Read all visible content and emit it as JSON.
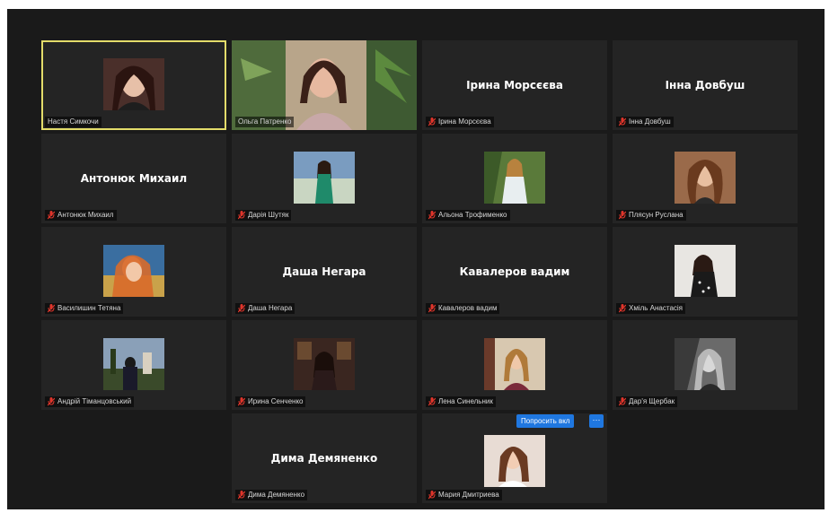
{
  "participants": [
    {
      "name": "Настя Симкочи",
      "mic": "",
      "video": true
    },
    {
      "name": "Ольга Патренко",
      "mic": "",
      "video": true
    },
    {
      "name": "Ірина Морсєєва",
      "display": "Ірина Морсєєва",
      "mic": "muted",
      "video": false
    },
    {
      "name": "Інна Довбуш",
      "display": "Інна Довбуш",
      "mic": "muted",
      "video": false
    },
    {
      "name": "Антонюк Михаил",
      "display": "Антонюк Михаил",
      "mic": "muted",
      "video": false
    },
    {
      "name": "Дарія Шутяк",
      "mic": "muted",
      "video": true
    },
    {
      "name": "Альона Трофименко",
      "mic": "muted",
      "video": true
    },
    {
      "name": "Плясун Руслана",
      "mic": "muted",
      "video": true
    },
    {
      "name": "Василишин Тетяна",
      "mic": "muted",
      "video": true
    },
    {
      "name": "Даша Негара",
      "display": "Даша Негара",
      "mic": "muted",
      "video": false
    },
    {
      "name": "Кавалеров вадим",
      "display": "Кавалеров вадим",
      "mic": "muted",
      "video": false
    },
    {
      "name": "Хміль Анастасія",
      "mic": "muted",
      "video": true
    },
    {
      "name": "Андрій Тіманцовський",
      "mic": "muted",
      "video": true
    },
    {
      "name": "Ирина Сенченко",
      "mic": "muted",
      "video": true
    },
    {
      "name": "Лена Синельник",
      "mic": "muted",
      "video": true
    },
    {
      "name": "Дар'я Щербак",
      "mic": "muted",
      "video": true
    },
    {
      "name": "Дима Демяненко",
      "display": "Дима Демяненко",
      "mic": "muted",
      "video": false
    },
    {
      "name": "Мария Дмитриева",
      "mic": "muted",
      "video": true
    }
  ],
  "hover_actions": {
    "ask_label": "Попросить вкл",
    "more_label": "···"
  },
  "colors": {
    "window_bg": "#1a1a1a",
    "tile_bg": "#242424",
    "active_speaker_border": "#e3dc6a",
    "muted_mic": "#e0352b",
    "button_blue": "#1f77e0"
  },
  "icons": {
    "mic": "muted-mic-icon",
    "more": "more-options-icon"
  }
}
